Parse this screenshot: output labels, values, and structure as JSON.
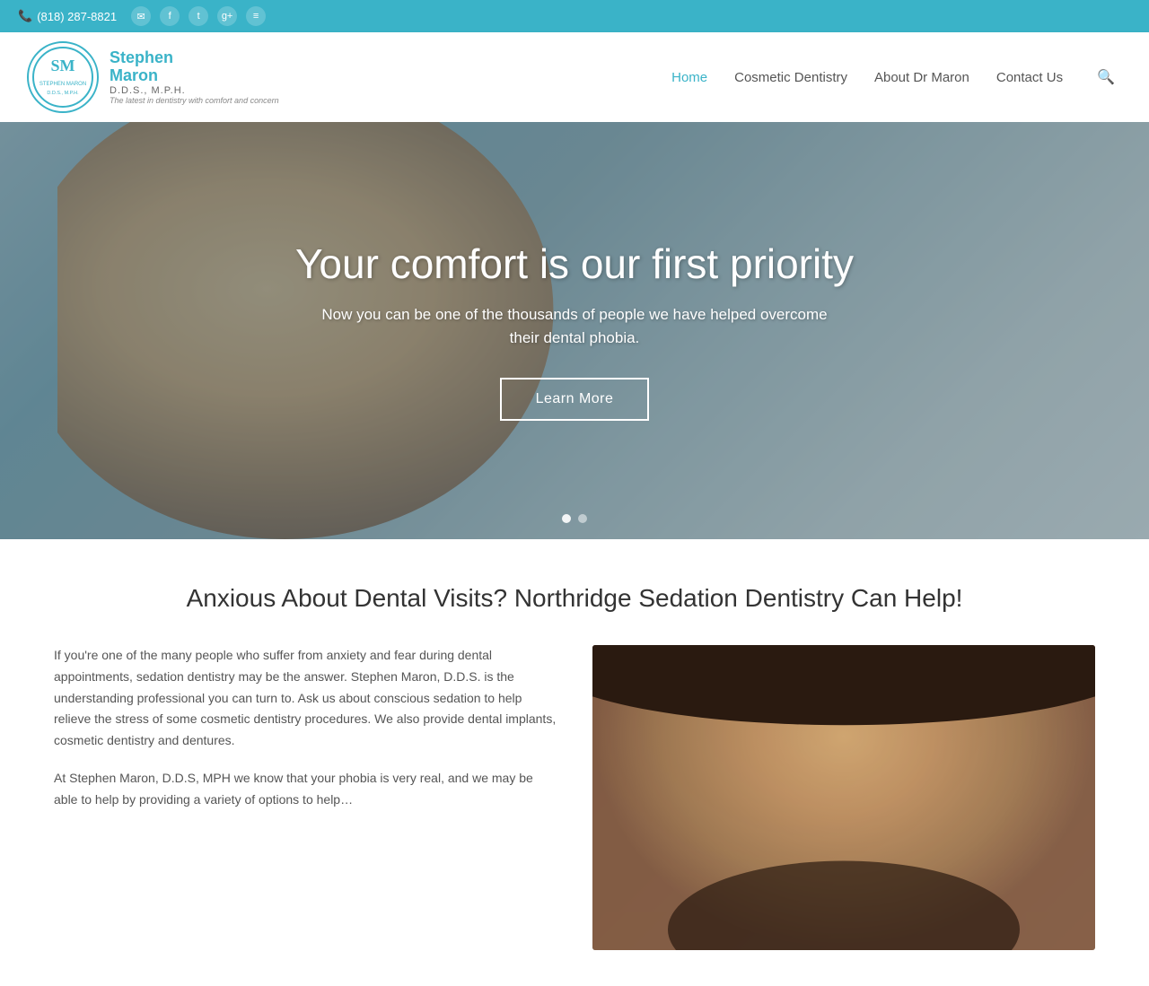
{
  "topbar": {
    "phone": "(818) 287-8821",
    "icons": [
      "✉",
      "f",
      "t",
      "g+",
      "rss"
    ]
  },
  "nav": {
    "logo": {
      "initials": "SM",
      "name_line1": "Stephen",
      "name_line2": "Maron",
      "credentials": "D.D.S., M.P.H.",
      "tagline": "The latest in dentistry with comfort and concern"
    },
    "links": [
      {
        "label": "Home",
        "active": true
      },
      {
        "label": "Cosmetic Dentistry",
        "active": false
      },
      {
        "label": "About Dr Maron",
        "active": false
      },
      {
        "label": "Contact Us",
        "active": false
      }
    ],
    "search_placeholder": "Search…"
  },
  "hero": {
    "title": "Your comfort is our first priority",
    "subtitle": "Now you can be one of the thousands of people we have helped overcome their dental phobia.",
    "cta_label": "Learn More",
    "slides": [
      "slide1",
      "slide2"
    ],
    "active_slide": 0
  },
  "section": {
    "heading": "Anxious About Dental Visits? Northridge Sedation Dentistry Can Help!",
    "paragraph1": "If you're one of the many people who suffer from anxiety and fear during dental appointments, sedation dentistry may be the answer. Stephen Maron, D.D.S. is the understanding professional you can turn to. Ask us about conscious sedation to help relieve the stress of some cosmetic dentistry procedures. We also provide dental implants, cosmetic dentistry and dentures.",
    "paragraph2": "At Stephen Maron, D.D.S, MPH we know that your phobia is very real, and we may be able to help by providing a variety of options to help…"
  },
  "colors": {
    "brand": "#3ab3c8",
    "text": "#555555",
    "heading": "#333333"
  }
}
